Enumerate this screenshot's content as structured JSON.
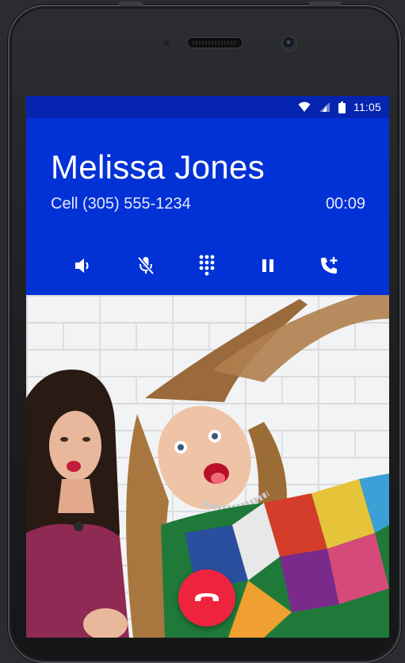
{
  "status_bar": {
    "time": "11:05",
    "icons": [
      "wifi-icon",
      "cell-signal-icon",
      "battery-icon"
    ]
  },
  "call": {
    "caller_name": "Melissa Jones",
    "number_label": "Cell (305) 555-1234",
    "duration": "00:09"
  },
  "controls": [
    "speaker-icon",
    "mute-icon",
    "dialpad-icon",
    "hold-icon",
    "add-call-icon"
  ],
  "end_call": {
    "icon": "end-call-icon"
  },
  "colors": {
    "status_bar": "#0524b0",
    "header": "#0232d6",
    "end_call": "#f0233f"
  }
}
